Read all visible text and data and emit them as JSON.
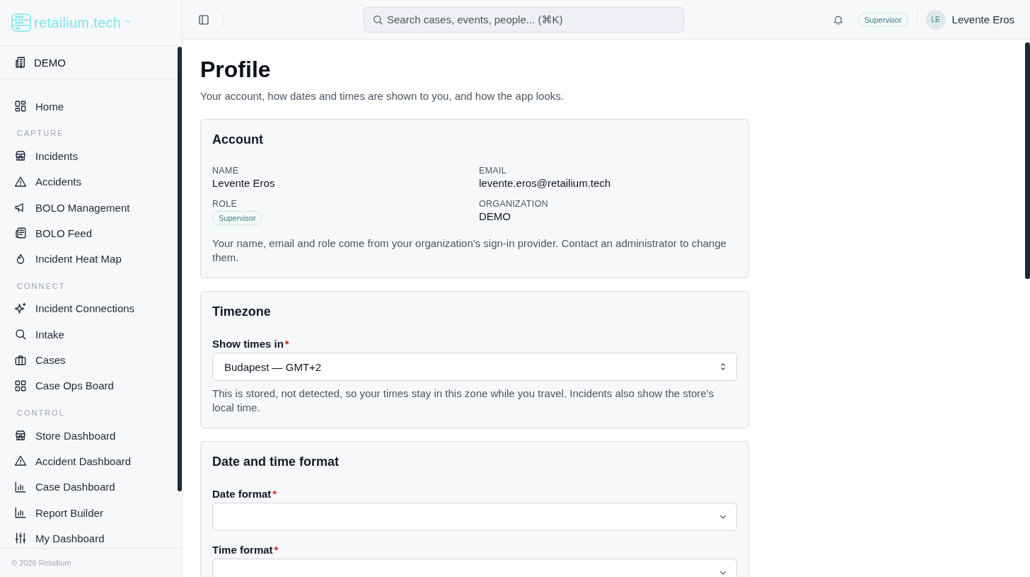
{
  "brand": {
    "name": "retailium.tech",
    "mark": "™"
  },
  "sidebar": {
    "organization": "DEMO",
    "sections": [
      {
        "items": [
          {
            "label": "Home"
          }
        ]
      },
      {
        "heading": "CAPTURE",
        "items": [
          {
            "label": "Incidents"
          },
          {
            "label": "Accidents"
          },
          {
            "label": "BOLO Management"
          },
          {
            "label": "BOLO Feed"
          },
          {
            "label": "Incident Heat Map"
          }
        ]
      },
      {
        "heading": "CONNECT",
        "items": [
          {
            "label": "Incident Connections"
          },
          {
            "label": "Intake"
          },
          {
            "label": "Cases"
          },
          {
            "label": "Case Ops Board"
          }
        ]
      },
      {
        "heading": "CONTROL",
        "items": [
          {
            "label": "Store Dashboard"
          },
          {
            "label": "Accident Dashboard"
          },
          {
            "label": "Case Dashboard"
          },
          {
            "label": "Report Builder"
          },
          {
            "label": "My Dashboard"
          }
        ]
      }
    ],
    "footer": "© 2026 Retailium"
  },
  "header": {
    "search": {
      "placeholder": "Search cases, events, people... (⌘K)"
    },
    "role_badge": "Supervisor",
    "user": {
      "initials": "LE",
      "name": "Levente Eros"
    }
  },
  "page": {
    "title": "Profile",
    "subtitle": "Your account, how dates and times are shown to you, and how the app looks.",
    "cards": [
      {
        "kind": "account",
        "title": "Account",
        "fields": [
          {
            "kind": "text",
            "label": "NAME",
            "value": "Levente Eros"
          },
          {
            "kind": "text",
            "label": "EMAIL",
            "value": "levente.eros@retailium.tech"
          },
          {
            "kind": "badge",
            "label": "ROLE",
            "value": "Supervisor"
          },
          {
            "kind": "text",
            "label": "ORGANIZATION",
            "value": "DEMO"
          }
        ],
        "note": "Your name, email and role come from your organization's sign-in provider. Contact an administrator to change them."
      },
      {
        "kind": "form",
        "title": "Timezone",
        "selects": [
          {
            "label": "Show times in",
            "required_mark": "*",
            "value": "Budapest — GMT+2",
            "kind": "spinner"
          }
        ],
        "note": "This is stored, not detected, so your times stay in this zone while you travel. Incidents also show the store's local time."
      },
      {
        "kind": "form",
        "title": "Date and time format",
        "selects": [
          {
            "label": "Date format",
            "required_mark": "*",
            "kind": "dropdown"
          },
          {
            "label": "Time format",
            "required_mark": "*",
            "kind": "dropdown"
          }
        ]
      }
    ]
  }
}
